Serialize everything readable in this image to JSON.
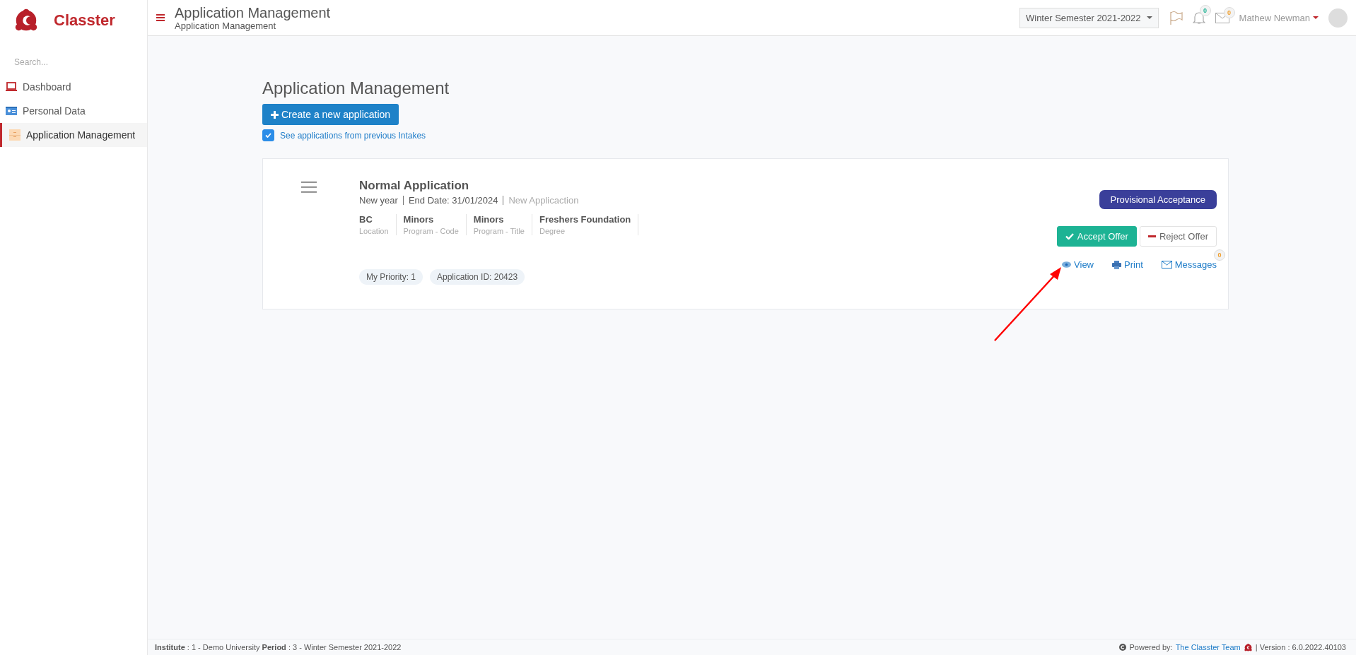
{
  "brand": {
    "name": "Classter"
  },
  "sidebar": {
    "search_placeholder": "Search...",
    "items": [
      {
        "label": "Dashboard",
        "kind": "laptop",
        "selected": false
      },
      {
        "label": "Personal Data",
        "kind": "idcard",
        "selected": false
      },
      {
        "label": "Application Management",
        "kind": "drawer",
        "selected": true
      }
    ]
  },
  "header": {
    "title": "Application Management",
    "subtitle": "Application Management",
    "period": "Winter Semester 2021-2022",
    "notifications_count": "0",
    "messages_count": "0",
    "user_name": "Mathew Newman"
  },
  "page": {
    "title": "Application Management",
    "create_button": "Create a new application",
    "previous_intakes": {
      "label": "See applications from previous Intakes",
      "checked": true
    }
  },
  "applications": [
    {
      "title": "Normal Application",
      "year": "New year",
      "end_date": "End Date: 31/01/2024",
      "state": "New Applicaction",
      "fields": [
        {
          "value": "BC",
          "label": "Location"
        },
        {
          "value": "Minors",
          "label": "Program - Code"
        },
        {
          "value": "Minors",
          "label": "Program - Title"
        },
        {
          "value": "Freshers Foundation",
          "label": "Degree"
        }
      ],
      "status": "Provisional Acceptance",
      "accept_button": "Accept Offer",
      "reject_button": "Reject Offer",
      "tags": [
        "My Priority: 1",
        "Application ID: 20423"
      ],
      "actions": [
        {
          "label": "View",
          "kind": "view"
        },
        {
          "label": "Print",
          "kind": "print"
        },
        {
          "label": "Messages",
          "kind": "messages",
          "count": "0"
        }
      ]
    }
  ],
  "footer": {
    "left": "**Institute** : 1 - Demo University **Period** : 3 - Winter Semester 2021-2022",
    "powered_by": "Powered by:",
    "team_link": "The Classter Team",
    "version": "| Version : 6.0.2022.40103"
  }
}
